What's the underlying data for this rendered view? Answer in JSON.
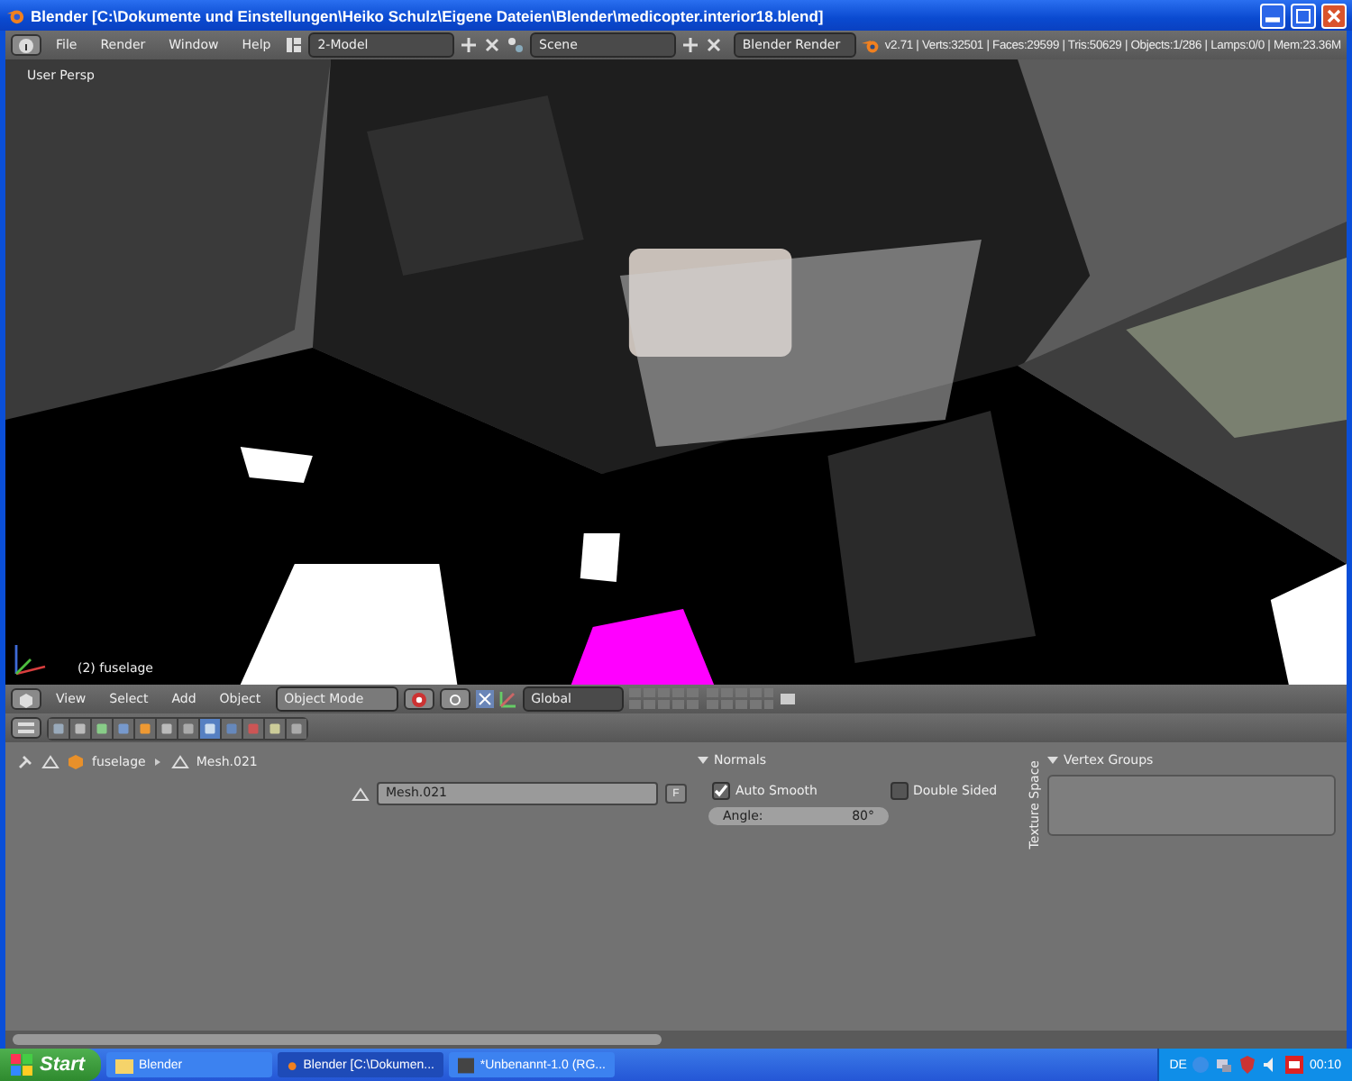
{
  "window": {
    "title": "Blender [C:\\Dokumente und Einstellungen\\Heiko Schulz\\Eigene Dateien\\Blender\\medicopter.interior18.blend]"
  },
  "menubar": {
    "menus": [
      "File",
      "Render",
      "Window",
      "Help"
    ],
    "layout": "2-Model",
    "scene": "Scene",
    "engine": "Blender Render",
    "stats": "v2.71 | Verts:32501 | Faces:29599 | Tris:50629 | Objects:1/286 | Lamps:0/0 | Mem:23.36M"
  },
  "viewport": {
    "view_label": "User Persp",
    "object_label": "(2) fuselage"
  },
  "viewport_header": {
    "menus": [
      "View",
      "Select",
      "Add",
      "Object"
    ],
    "mode": "Object Mode",
    "orientation": "Global"
  },
  "properties_tabs": [
    {
      "selected": false
    },
    {
      "selected": false
    },
    {
      "selected": false
    },
    {
      "selected": false
    },
    {
      "selected": false
    },
    {
      "selected": false
    },
    {
      "selected": false
    },
    {
      "selected": true
    },
    {
      "selected": false
    },
    {
      "selected": false
    },
    {
      "selected": false
    },
    {
      "selected": false
    }
  ],
  "properties": {
    "breadcrumb": [
      "fuselage",
      "Mesh.021"
    ],
    "mesh_name": "Mesh.021",
    "fake_user": "F",
    "normals": {
      "title": "Normals",
      "options": [
        {
          "label": "Auto Smooth",
          "checked": true
        },
        {
          "label": "Double Sided",
          "checked": false
        }
      ],
      "angle_label": "Angle:",
      "angle_value": "80°"
    },
    "side_tab": "Texture Space",
    "vertex_groups": {
      "title": "Vertex Groups"
    }
  },
  "taskbar": {
    "start": "Start",
    "tasks": [
      {
        "label": "Blender",
        "selected": false
      },
      {
        "label": "Blender [C:\\Dokumen...",
        "selected": true
      },
      {
        "label": "*Unbenannt-1.0 (RG...",
        "selected": false
      }
    ],
    "language": "DE",
    "clock": "00:10"
  }
}
